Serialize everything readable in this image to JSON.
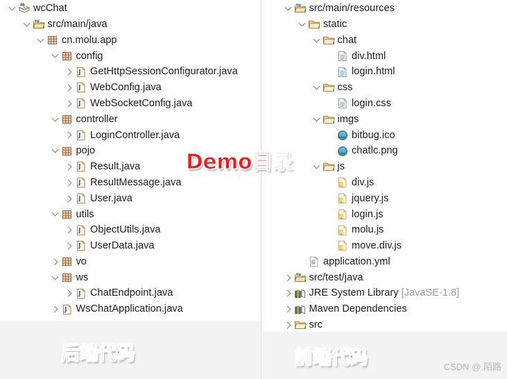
{
  "watermarks": {
    "demo": "Demo目录",
    "backend": "后端代码",
    "frontend": "前端代码",
    "credit": "CSDN @.陌路"
  },
  "left_tree": {
    "name": "backend-project-tree",
    "rows": [
      {
        "label": "wcChat",
        "depth": 0,
        "twisty": "expanded",
        "icon": "maven-project-icon"
      },
      {
        "label": "src/main/java",
        "depth": 1,
        "twisty": "expanded",
        "icon": "source-folder-icon"
      },
      {
        "label": "cn.molu.app",
        "depth": 2,
        "twisty": "expanded",
        "icon": "package-icon"
      },
      {
        "label": "config",
        "depth": 3,
        "twisty": "expanded",
        "icon": "package-icon"
      },
      {
        "label": "GetHttpSessionConfigurator.java",
        "depth": 4,
        "twisty": "collapsed",
        "icon": "java-file-icon"
      },
      {
        "label": "WebConfig.java",
        "depth": 4,
        "twisty": "collapsed",
        "icon": "java-file-icon"
      },
      {
        "label": "WebSocketConfig.java",
        "depth": 4,
        "twisty": "collapsed",
        "icon": "java-file-icon"
      },
      {
        "label": "controller",
        "depth": 3,
        "twisty": "expanded",
        "icon": "package-icon"
      },
      {
        "label": "LoginController.java",
        "depth": 4,
        "twisty": "collapsed",
        "icon": "java-file-icon"
      },
      {
        "label": "pojo",
        "depth": 3,
        "twisty": "expanded",
        "icon": "package-icon"
      },
      {
        "label": "Result.java",
        "depth": 4,
        "twisty": "collapsed",
        "icon": "java-file-icon"
      },
      {
        "label": "ResultMessage.java",
        "depth": 4,
        "twisty": "collapsed",
        "icon": "java-file-icon"
      },
      {
        "label": "User.java",
        "depth": 4,
        "twisty": "collapsed",
        "icon": "java-file-icon"
      },
      {
        "label": "utils",
        "depth": 3,
        "twisty": "expanded",
        "icon": "package-icon"
      },
      {
        "label": "ObjectUtils.java",
        "depth": 4,
        "twisty": "collapsed",
        "icon": "java-file-icon"
      },
      {
        "label": "UserData.java",
        "depth": 4,
        "twisty": "collapsed",
        "icon": "java-file-icon"
      },
      {
        "label": "vo",
        "depth": 3,
        "twisty": "collapsed",
        "icon": "package-icon"
      },
      {
        "label": "ws",
        "depth": 3,
        "twisty": "expanded",
        "icon": "package-icon"
      },
      {
        "label": "ChatEndpoint.java",
        "depth": 4,
        "twisty": "collapsed",
        "icon": "java-file-icon"
      },
      {
        "label": "WsChatApplication.java",
        "depth": 3,
        "twisty": "collapsed",
        "icon": "java-file-icon"
      }
    ]
  },
  "right_tree": {
    "name": "frontend-project-tree",
    "rows": [
      {
        "label": "src/main/resources",
        "depth": 1,
        "twisty": "expanded",
        "icon": "source-folder-icon"
      },
      {
        "label": "static",
        "depth": 2,
        "twisty": "expanded",
        "icon": "folder-icon"
      },
      {
        "label": "chat",
        "depth": 3,
        "twisty": "expanded",
        "icon": "folder-icon"
      },
      {
        "label": "div.html",
        "depth": 4,
        "twisty": "blank",
        "icon": "html-file-icon"
      },
      {
        "label": "login.html",
        "depth": 4,
        "twisty": "blank",
        "icon": "html-file-icon"
      },
      {
        "label": "css",
        "depth": 3,
        "twisty": "expanded",
        "icon": "folder-icon"
      },
      {
        "label": "login.css",
        "depth": 4,
        "twisty": "blank",
        "icon": "html-file-icon"
      },
      {
        "label": "imgs",
        "depth": 3,
        "twisty": "expanded",
        "icon": "folder-icon"
      },
      {
        "label": "bitbug.ico",
        "depth": 4,
        "twisty": "blank",
        "icon": "image-file-icon"
      },
      {
        "label": "chatlc.png",
        "depth": 4,
        "twisty": "blank",
        "icon": "image-file-icon"
      },
      {
        "label": "js",
        "depth": 3,
        "twisty": "expanded",
        "icon": "folder-icon"
      },
      {
        "label": "div.js",
        "depth": 4,
        "twisty": "blank",
        "icon": "js-file-icon"
      },
      {
        "label": "jquery.js",
        "depth": 4,
        "twisty": "blank",
        "icon": "js-file-icon"
      },
      {
        "label": "login.js",
        "depth": 4,
        "twisty": "blank",
        "icon": "js-file-icon"
      },
      {
        "label": "molu.js",
        "depth": 4,
        "twisty": "blank",
        "icon": "js-file-icon"
      },
      {
        "label": "move.div.js",
        "depth": 4,
        "twisty": "blank",
        "icon": "js-file-icon"
      },
      {
        "label": "application.yml",
        "depth": 2,
        "twisty": "blank",
        "icon": "yml-file-icon"
      },
      {
        "label": "src/test/java",
        "depth": 1,
        "twisty": "collapsed",
        "icon": "source-folder-icon"
      },
      {
        "label": "JRE System Library",
        "suffix": " [JavaSE-1.8]",
        "depth": 1,
        "twisty": "collapsed",
        "icon": "library-icon"
      },
      {
        "label": "Maven Dependencies",
        "depth": 1,
        "twisty": "collapsed",
        "icon": "library-icon"
      },
      {
        "label": "src",
        "depth": 1,
        "twisty": "collapsed",
        "icon": "folder-icon"
      }
    ]
  },
  "colors": {
    "accent_red": "#f01c1c",
    "footer_gray": "#f3f3f3",
    "text": "#1c1c1c",
    "dim_text": "#9a9a9a"
  }
}
